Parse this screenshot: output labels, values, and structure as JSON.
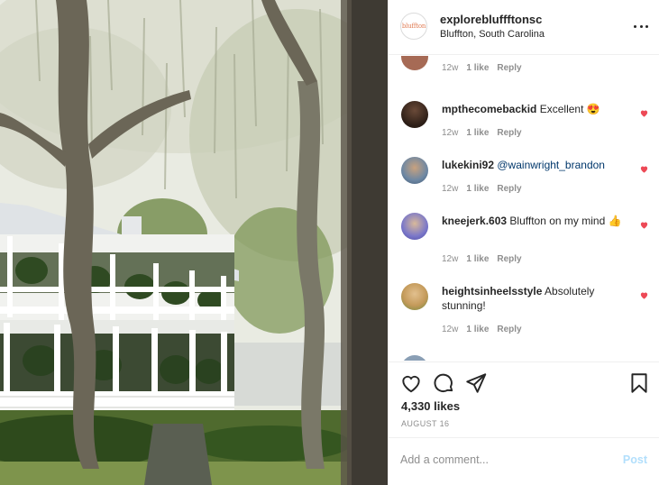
{
  "post": {
    "username": "explorebluffftonsc",
    "avatar_text": "bluffton",
    "location": "Bluffton, South Carolina",
    "likes": "4,330 likes",
    "date": "AUGUST 16"
  },
  "comments": [
    {
      "username": "",
      "text": "",
      "time": "12w",
      "likes": "1 like",
      "reply": "Reply",
      "avatar": "#a66a55"
    },
    {
      "username": "mpthecomebackid",
      "text": "Excellent 😍",
      "mention": "",
      "time": "12w",
      "likes": "1 like",
      "reply": "Reply",
      "avatar": "#3b2a20"
    },
    {
      "username": "lukekini92",
      "text": "",
      "mention": "@wainwright_brandon",
      "time": "12w",
      "likes": "1 like",
      "reply": "Reply",
      "avatar": "#6d87a3"
    },
    {
      "username": "kneejerk.603",
      "text": "Bluffton on my mind 👍",
      "mention": "",
      "time": "12w",
      "likes": "1 like",
      "reply": "Reply",
      "avatar": "#7a77c9"
    },
    {
      "username": "heightsinheelsstyle",
      "text": "Absolutely stunning!",
      "mention": "",
      "time": "12w",
      "likes": "1 like",
      "reply": "Reply",
      "avatar": "#c49a5a"
    }
  ],
  "composer": {
    "placeholder": "Add a comment...",
    "post_label": "Post"
  },
  "colors": {
    "heart_red": "#ed4956",
    "post_disabled": "#b2dffc",
    "muted": "#8e8e8e",
    "mention": "#00376b"
  },
  "icons": [
    "heart-icon",
    "comment-icon",
    "share-icon",
    "bookmark-icon",
    "more-icon",
    "like-comment-heart-icon"
  ]
}
